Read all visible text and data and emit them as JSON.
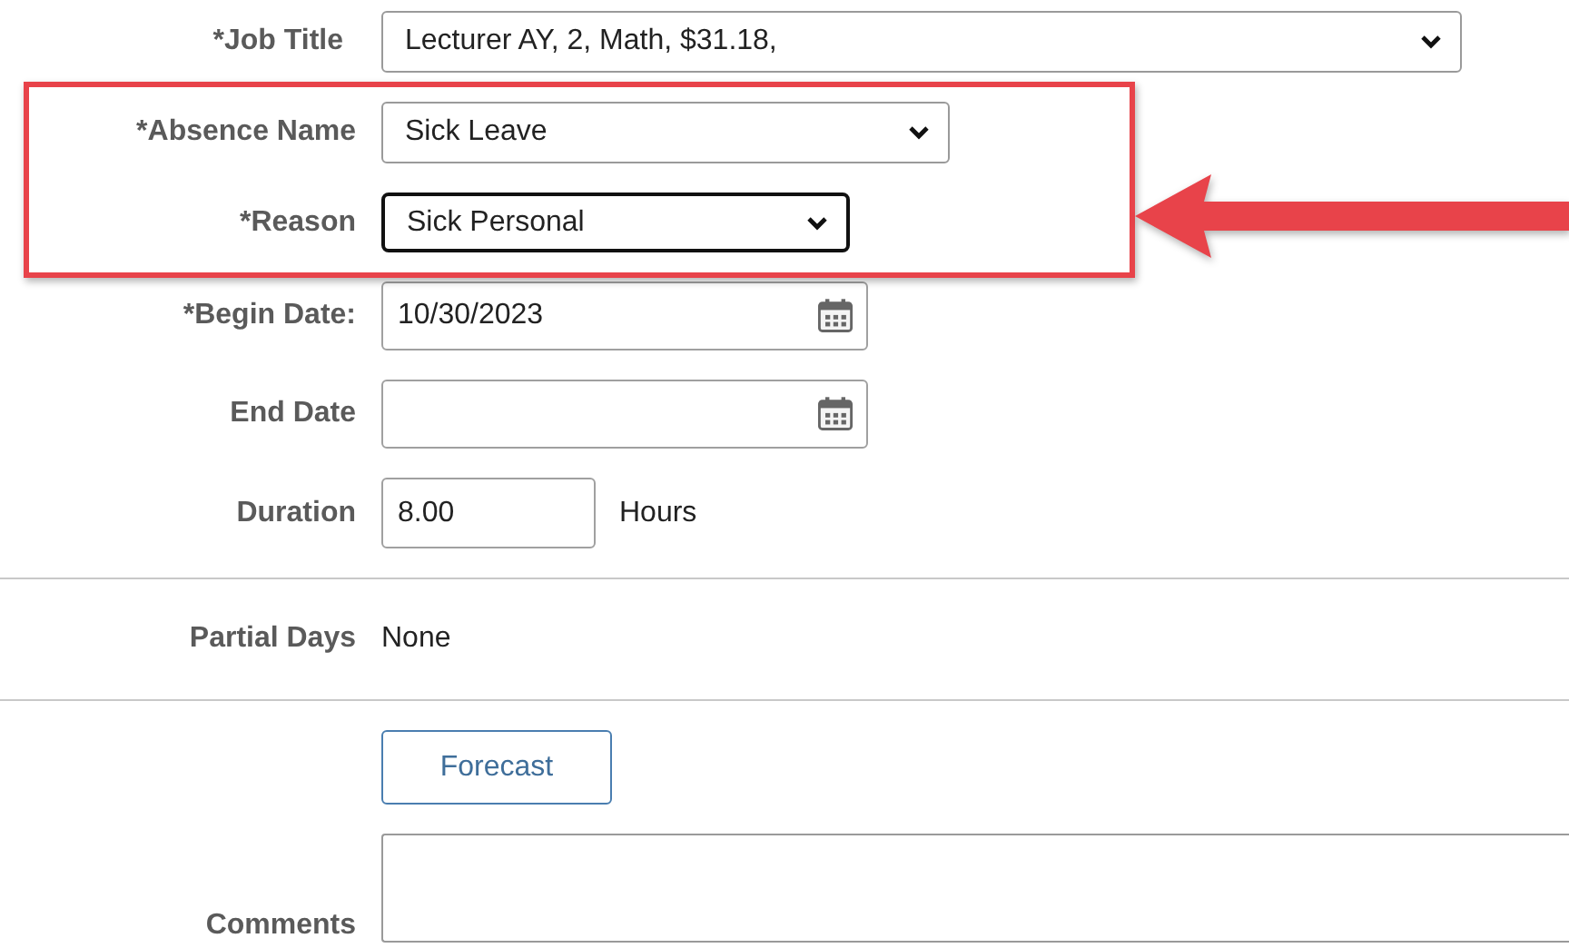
{
  "sections": [
    [
      {
        "kind": "select",
        "label": "*Job Title",
        "value": "Lecturer AY, 2, Math, $31.18,",
        "focused": false
      },
      {
        "kind": "select",
        "label": "*Absence Name",
        "value": "Sick Leave",
        "focused": false
      },
      {
        "kind": "select",
        "label": "*Reason",
        "value": "Sick Personal",
        "focused": true
      },
      {
        "kind": "date",
        "label": "*Begin Date:",
        "value": "10/30/2023",
        "focused": false
      },
      {
        "kind": "date",
        "label": "End Date",
        "focused": false
      },
      {
        "kind": "number",
        "label": "Duration",
        "value": "8.00",
        "unit": "Hours",
        "focused": false
      }
    ],
    [
      {
        "kind": "text",
        "label": "Partial Days",
        "value": "None"
      }
    ],
    [
      {
        "kind": "button",
        "value": "Forecast"
      },
      {
        "kind": "textarea",
        "label": "Comments",
        "focused": false
      }
    ]
  ],
  "annotation": {
    "highlight": true,
    "arrow": true
  }
}
